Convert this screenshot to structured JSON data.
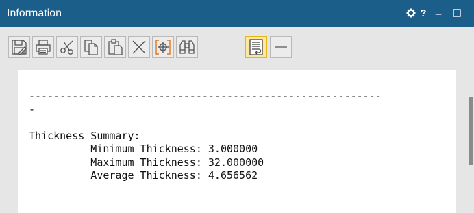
{
  "window": {
    "title": "Information",
    "controls": [
      {
        "name": "settings",
        "icon": "gear-icon"
      },
      {
        "name": "help",
        "icon": "question-icon",
        "glyph": "?"
      },
      {
        "name": "minimize",
        "icon": "minimize-icon",
        "glyph": "_"
      },
      {
        "name": "maximize",
        "icon": "maximize-icon"
      }
    ],
    "title_bar_color": "#1b5e8a"
  },
  "toolbar": {
    "buttons": [
      {
        "name": "save",
        "icon": "save-icon"
      },
      {
        "name": "print",
        "icon": "printer-icon"
      },
      {
        "name": "cut",
        "icon": "scissors-icon"
      },
      {
        "name": "copy",
        "icon": "copy-icon"
      },
      {
        "name": "paste",
        "icon": "paste-icon"
      },
      {
        "name": "clear",
        "icon": "delete-x-icon"
      },
      {
        "name": "select",
        "icon": "crosshair-select-icon"
      },
      {
        "name": "find",
        "icon": "binoculars-icon"
      },
      {
        "name": "word-wrap",
        "icon": "word-wrap-icon",
        "active": true
      },
      {
        "name": "separator-line",
        "icon": "horizontal-line-icon"
      }
    ],
    "active_color": "#fbe9a3"
  },
  "output": {
    "lines": [
      "---------------------------------------------------------",
      "-",
      "",
      "Thickness Summary:",
      "          Minimum Thickness: 3.000000",
      "          Maximum Thickness: 32.000000",
      "          Average Thickness: 4.656562"
    ]
  }
}
